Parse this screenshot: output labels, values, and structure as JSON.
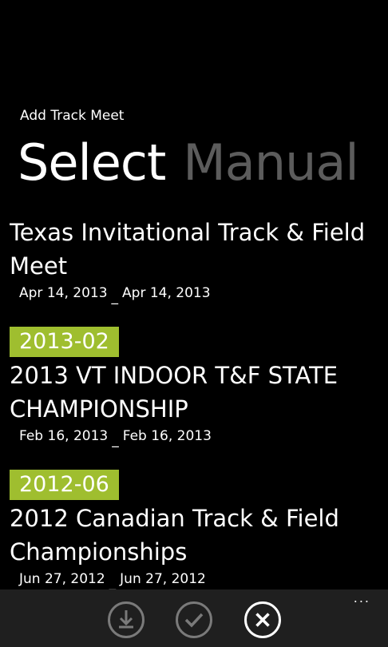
{
  "app_title": "Add Track Meet",
  "pivot": {
    "items": [
      {
        "label": "Select",
        "active": true
      },
      {
        "label": "Manual",
        "active": false
      }
    ]
  },
  "meets": [
    {
      "month_tag": "",
      "name": "Texas Invitational Track & Field Meet",
      "start_date": "Apr 14, 2013",
      "separator": "_",
      "end_date": "Apr 14, 2013"
    },
    {
      "month_tag": "2013-02",
      "name": "2013 VT INDOOR T&F STATE CHAMPIONSHIP",
      "start_date": "Feb 16, 2013",
      "separator": "_",
      "end_date": "Feb 16, 2013"
    },
    {
      "month_tag": "2012-06",
      "name": "2012 Canadian Track & Field Championships",
      "start_date": "Jun 27, 2012",
      "separator": "_",
      "end_date": "Jun 27, 2012"
    }
  ],
  "app_bar": {
    "buttons": [
      {
        "icon": "download-icon",
        "label": "download"
      },
      {
        "icon": "check-icon",
        "label": "check"
      },
      {
        "icon": "close-icon",
        "label": "cancel"
      }
    ],
    "more_label": "..."
  },
  "colors": {
    "background": "#000000",
    "accent": "#9fbe2f",
    "inactive_pivot": "#5c5c5c",
    "app_bar": "#1f1f1f",
    "disabled_icon": "#7a7a7a"
  }
}
